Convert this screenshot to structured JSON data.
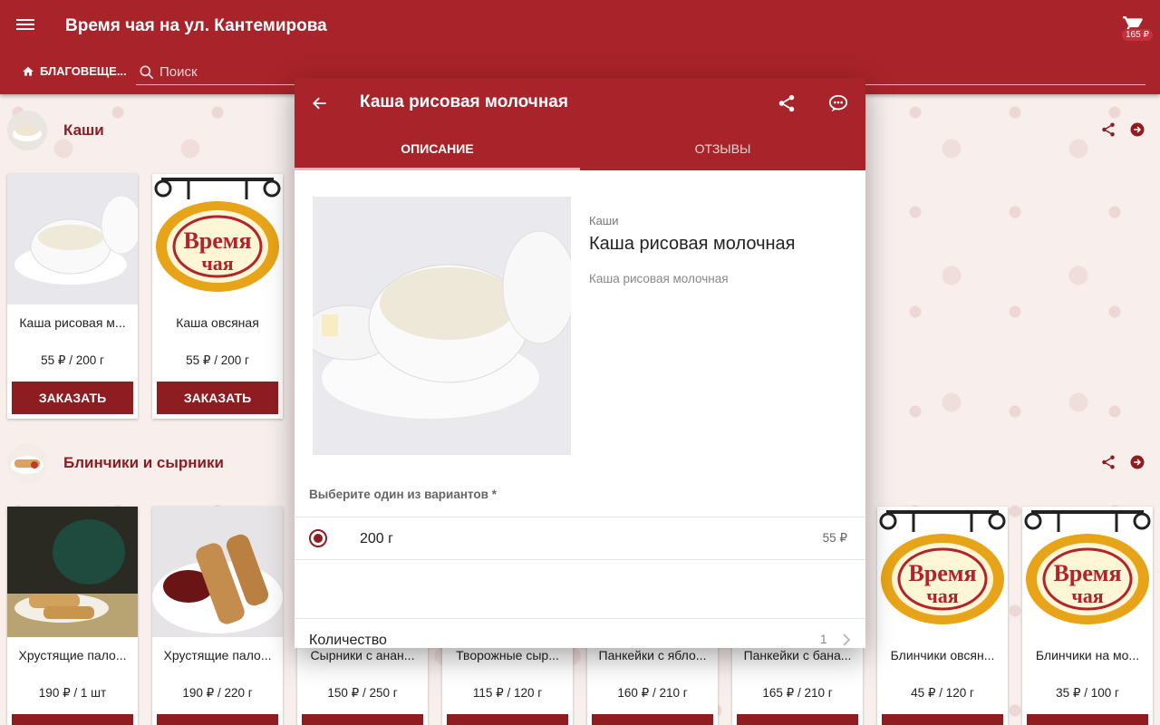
{
  "app": {
    "title": "Время чая на ул. Кантемирова",
    "location": "БЛАГОВЕЩЕ...",
    "search_placeholder": "Поиск",
    "cart_total": "165 ₽"
  },
  "sections": [
    {
      "title": "Каши",
      "products": [
        {
          "name": "Каша рисовая м...",
          "price": "55 ₽ / 200 г",
          "order": "ЗАКАЗАТЬ",
          "image": "porridge-bowl"
        },
        {
          "name": "Каша овсяная",
          "price": "55 ₽ / 200 г",
          "order": "ЗАКАЗАТЬ",
          "image": "vremya-chaya-logo"
        }
      ]
    },
    {
      "title": "Блинчики и сырники",
      "products": [
        {
          "name": "Хрустящие пало...",
          "price": "190 ₽ / 1 шт",
          "order": "",
          "image": "crispy-rolls-tea"
        },
        {
          "name": "Хрустящие пало...",
          "price": "190 ₽ / 220 г",
          "order": "",
          "image": "crispy-rolls-beans"
        },
        {
          "name": "Сырники с анан...",
          "price": "150 ₽ / 250 г",
          "order": "",
          "image": ""
        },
        {
          "name": "Творожные сыр...",
          "price": "115 ₽ / 120 г",
          "order": "",
          "image": ""
        },
        {
          "name": "Панкейки с ябло...",
          "price": "160 ₽ / 210 г",
          "order": "",
          "image": ""
        },
        {
          "name": "Панкейки с бана...",
          "price": "165 ₽ / 210 г",
          "order": "",
          "image": ""
        },
        {
          "name": "Блинчики овсян...",
          "price": "45 ₽ / 120 г",
          "order": "",
          "image": "vremya-chaya-logo"
        },
        {
          "name": "Блинчики на мо...",
          "price": "35 ₽ / 100 г",
          "order": "",
          "image": "vremya-chaya-logo"
        }
      ]
    }
  ],
  "logo_text": {
    "line1": "Время",
    "line2": "чая"
  },
  "dialog": {
    "title": "Каша рисовая молочная",
    "tabs": [
      "ОПИСАНИЕ",
      "ОТЗЫВЫ"
    ],
    "active_tab": 0,
    "category": "Каши",
    "name": "Каша рисовая молочная",
    "description": "Каша рисовая молочная",
    "variant_prompt": "Выберите один из вариантов *",
    "variant": {
      "name": "200 г",
      "price": "55 ₽",
      "selected": true
    },
    "quantity_label": "Количество",
    "quantity": "1"
  },
  "colors": {
    "primary": "#a8242a",
    "button": "#8e1d22",
    "section_title": "#8e1d22"
  }
}
